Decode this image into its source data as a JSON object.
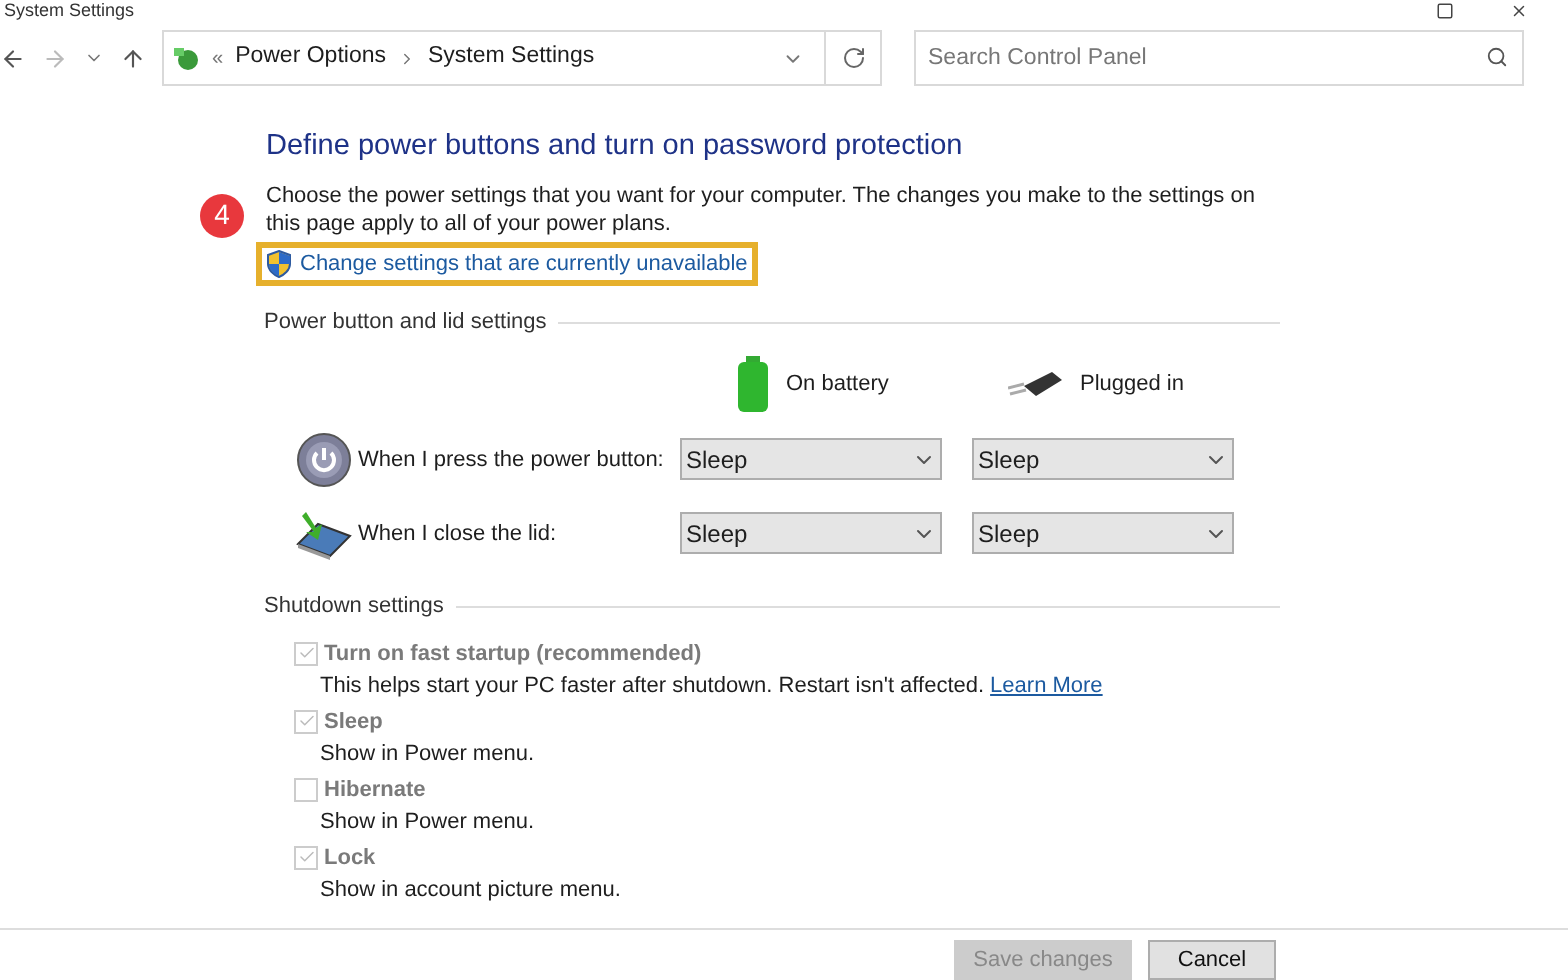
{
  "window": {
    "title": "System Settings"
  },
  "address_bar": {
    "overflow": "«",
    "breadcrumbs": [
      "Power Options",
      "System Settings"
    ]
  },
  "search": {
    "placeholder": "Search Control Panel"
  },
  "heading": "Define power buttons and turn on password protection",
  "description": "Choose the power settings that you want for your computer. The changes you make to the settings on this page apply to all of your power plans.",
  "step_badge": "4",
  "admin_link": "Change settings that are currently unavailable",
  "power_section": {
    "title": "Power button and lid settings",
    "columns": [
      "On battery",
      "Plugged in"
    ],
    "rows": [
      {
        "kind": "power",
        "label": "When I press the power button:",
        "values": [
          "Sleep",
          "Sleep"
        ]
      },
      {
        "kind": "lid",
        "label": "When I close the lid:",
        "values": [
          "Sleep",
          "Sleep"
        ]
      }
    ]
  },
  "shutdown_section": {
    "title": "Shutdown settings",
    "options": [
      {
        "label": "Turn on fast startup (recommended)",
        "description": "This helps start your PC faster after shutdown. Restart isn't affected.",
        "link": "Learn More",
        "checked": true,
        "disabled": true
      },
      {
        "label": "Sleep",
        "description": "Show in Power menu.",
        "checked": true,
        "disabled": true
      },
      {
        "label": "Hibernate",
        "description": "Show in Power menu.",
        "checked": false,
        "disabled": true
      },
      {
        "label": "Lock",
        "description": "Show in account picture menu.",
        "checked": true,
        "disabled": true
      }
    ]
  },
  "buttons": [
    {
      "label": "Save changes",
      "disabled": true
    },
    {
      "label": "Cancel",
      "disabled": false
    }
  ]
}
